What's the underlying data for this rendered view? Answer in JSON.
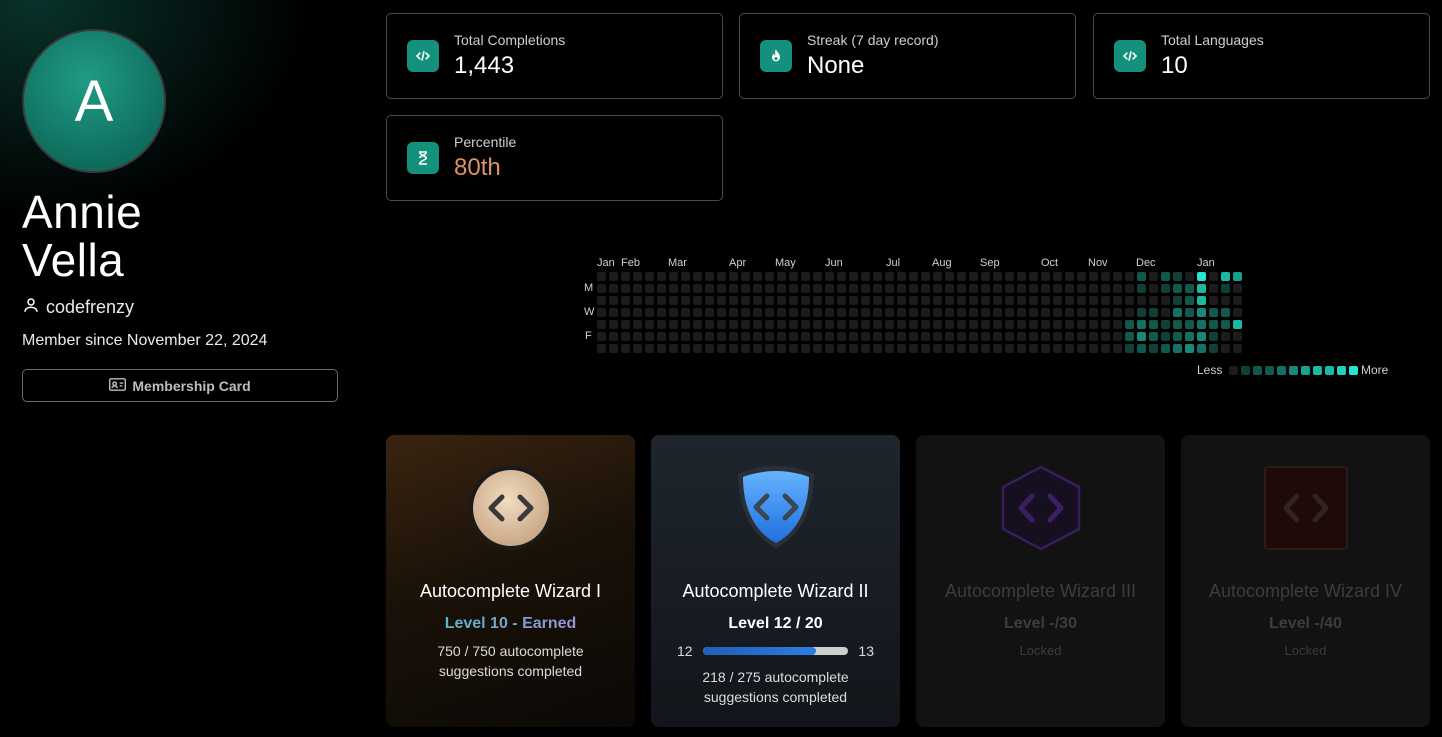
{
  "profile": {
    "avatar_letter": "A",
    "name_first": "Annie",
    "name_last": "Vella",
    "username": "codefrenzy",
    "member_since": "Member since November 22, 2024",
    "membership_card_label": "Membership Card"
  },
  "stats": [
    {
      "label": "Total Completions",
      "value": "1,443",
      "icon": "code-icon"
    },
    {
      "label": "Streak (7 day record)",
      "value": "None",
      "icon": "flame-icon"
    },
    {
      "label": "Total Languages",
      "value": "10",
      "icon": "code-icon"
    },
    {
      "label": "Percentile",
      "value": "80th",
      "icon": "hourglass-icon"
    }
  ],
  "heatmap": {
    "months": [
      "Jan",
      "Feb",
      "Mar",
      "Apr",
      "May",
      "Jun",
      "Jul",
      "Aug",
      "Sep",
      "Oct",
      "Nov",
      "Dec",
      "Jan"
    ],
    "days": [
      "M",
      "W",
      "F"
    ],
    "legend_less": "Less",
    "legend_more": "More",
    "palette": [
      "#1c1c1c",
      "#0f3f37",
      "#11594d",
      "#137063",
      "#16897a",
      "#18a08f",
      "#1bb8a4",
      "#20d0bb",
      "#26e6cf"
    ]
  },
  "badges": [
    {
      "title": "Autocomplete Wizard I",
      "level": "Level 10 - Earned",
      "desc": "750 / 750 autocomplete suggestions completed"
    },
    {
      "title": "Autocomplete Wizard II",
      "level": "Level 12 / 20",
      "progress_from": "12",
      "progress_to": "13",
      "progress": 0.78,
      "desc": "218 / 275 autocomplete suggestions completed"
    },
    {
      "title": "Autocomplete Wizard III",
      "level": "Level -/30",
      "status": "Locked"
    },
    {
      "title": "Autocomplete Wizard IV",
      "level": "Level -/40",
      "status": "Locked"
    }
  ]
}
